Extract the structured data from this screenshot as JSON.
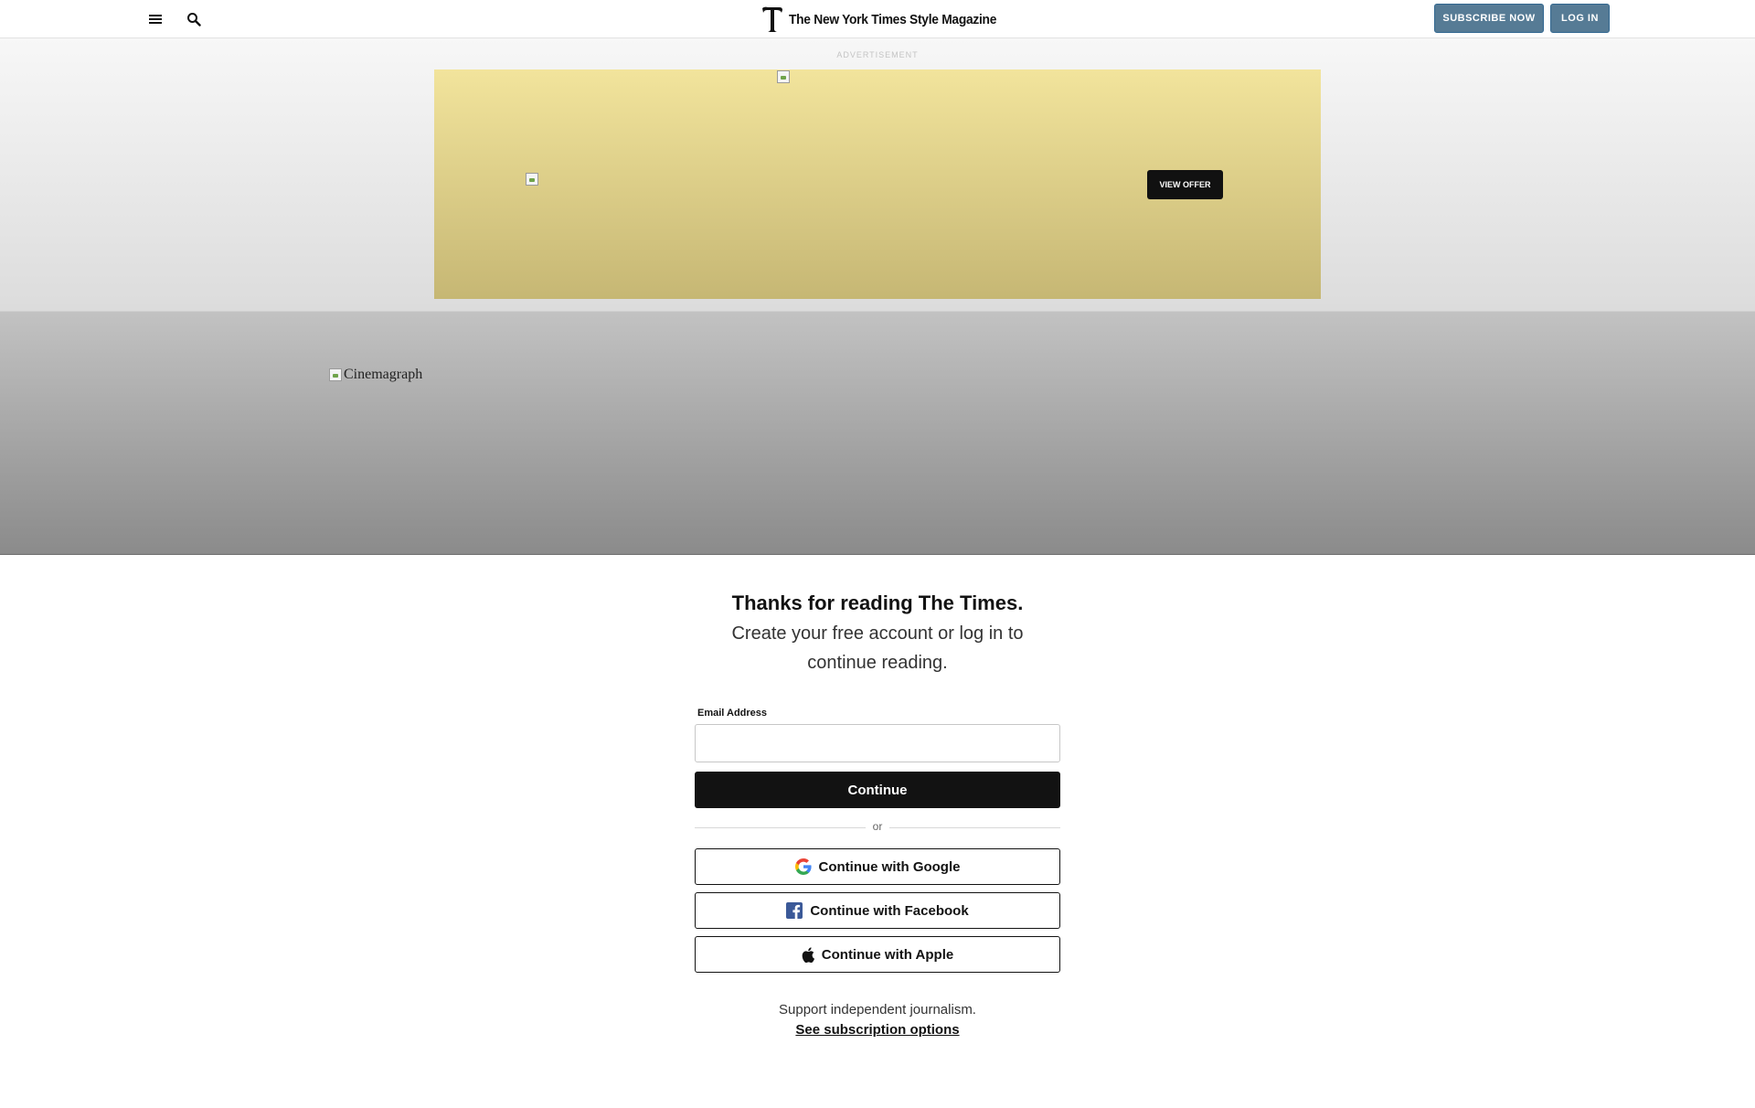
{
  "header": {
    "menu_icon": "hamburger-menu-icon",
    "search_icon": "search-icon",
    "logo_text": "The New York Times Style Magazine",
    "subscribe_label": "SUBSCRIBE NOW",
    "login_label": "LOG IN",
    "button_color": "#567b95"
  },
  "ad": {
    "label": "ADVERTISEMENT",
    "cta_label": "VIEW OFFER",
    "background_color": "#e8d98c"
  },
  "hero": {
    "image_alt": "Cinemagraph"
  },
  "login": {
    "title": "Thanks for reading The Times.",
    "subtitle_line1": "Create your free account or log in to",
    "subtitle_line2": "continue reading.",
    "email_label": "Email Address",
    "email_value": "",
    "continue_label": "Continue",
    "divider_text": "or",
    "google_label": "Continue with Google",
    "facebook_label": "Continue with Facebook",
    "apple_label": "Continue with Apple",
    "support_text": "Support independent journalism.",
    "subscription_link": "See subscription options"
  }
}
